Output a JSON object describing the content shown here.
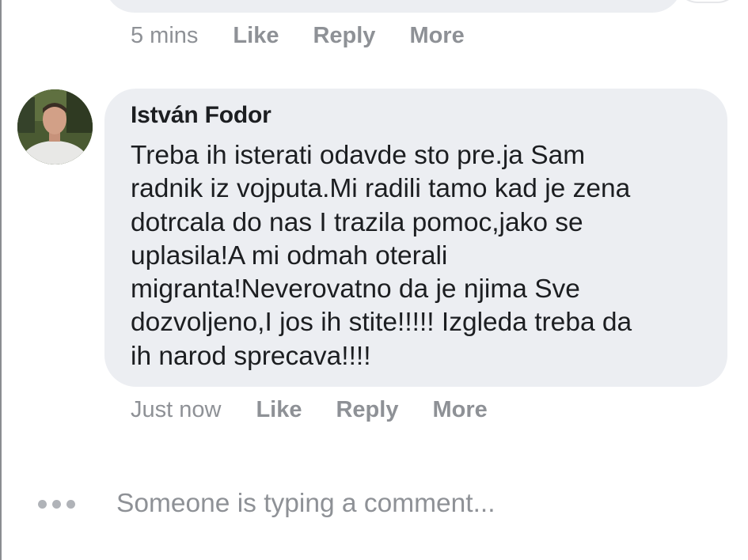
{
  "previous_comment": {
    "time": "5 mins",
    "like_label": "Like",
    "reply_label": "Reply",
    "more_label": "More"
  },
  "comment": {
    "author": "István Fodor",
    "text": "Treba ih isterati odavde sto pre.ja Sam\nradnik iz vojputa.Mi radili tamo kad je zena\ndotrcala do nas I trazila pomoc,jako se\nuplasila!A mi odmah oterali\nmigranta!Neverovatno da je njima Sve\ndozvoljeno,I jos ih stite!!!!! Izgleda treba da\nih narod sprecava!!!!",
    "time": "Just now",
    "like_label": "Like",
    "reply_label": "Reply",
    "more_label": "More"
  },
  "typing_indicator": {
    "text": "Someone is typing a comment..."
  },
  "colors": {
    "bubble_background": "#eceef2",
    "meta_text": "#8e9196",
    "primary_text": "#1c1e21"
  }
}
